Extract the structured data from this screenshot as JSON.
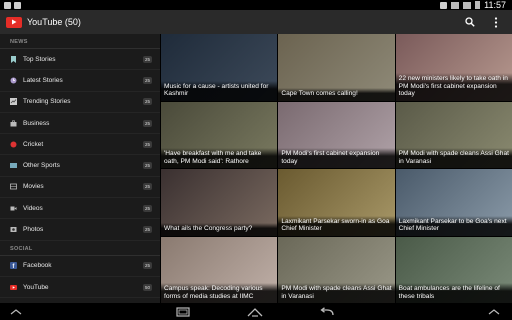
{
  "app": {
    "title": "YouTube (50)",
    "accent": "#e52d27"
  },
  "status": {
    "clock": "11:57"
  },
  "sidebar": {
    "sections": [
      {
        "header": "NEWS",
        "items": [
          {
            "label": "Top Stories",
            "count": "25",
            "icon": "bookmark-icon"
          },
          {
            "label": "Latest Stories",
            "count": "25",
            "icon": "clock-icon"
          },
          {
            "label": "Trending Stories",
            "count": "25",
            "icon": "trending-icon"
          },
          {
            "label": "Business",
            "count": "25",
            "icon": "briefcase-icon"
          },
          {
            "label": "Cricket",
            "count": "25",
            "icon": "cricket-icon"
          },
          {
            "label": "Other Sports",
            "count": "25",
            "icon": "sports-icon"
          },
          {
            "label": "Movies",
            "count": "25",
            "icon": "film-icon"
          },
          {
            "label": "Videos",
            "count": "25",
            "icon": "video-icon"
          },
          {
            "label": "Photos",
            "count": "25",
            "icon": "photo-icon"
          }
        ]
      },
      {
        "header": "SOCIAL",
        "items": [
          {
            "label": "Facebook",
            "count": "25",
            "icon": "facebook-icon"
          },
          {
            "label": "YouTube",
            "count": "50",
            "icon": "youtube-icon"
          }
        ]
      }
    ]
  },
  "tiles": [
    {
      "caption": "Music for a cause - artists united for Kashmir",
      "colors": [
        "#1f2b3a",
        "#3d4a5a"
      ]
    },
    {
      "caption": "Cape Town comes calling!",
      "colors": [
        "#6b6350",
        "#8f8a78"
      ]
    },
    {
      "caption": "22 new ministers likely to take oath in PM Modi's first cabinet expansion today",
      "colors": [
        "#7a5a5a",
        "#b89a90"
      ]
    },
    {
      "caption": "'Have breakfast with me and take oath, PM Modi said': Rathore",
      "colors": [
        "#4a4a3a",
        "#7a7a60"
      ]
    },
    {
      "caption": "PM Modi's first cabinet expansion today",
      "colors": [
        "#7a6a70",
        "#b0a2a8"
      ]
    },
    {
      "caption": "PM Modi with spade cleans Assi Ghat in Varanasi",
      "colors": [
        "#5a5a48",
        "#8a8a70"
      ]
    },
    {
      "caption": "What ails the Congress party?",
      "colors": [
        "#3a3030",
        "#7a6a60"
      ]
    },
    {
      "caption": "Laxmikant Parsekar sworn-in as Goa Chief Minister",
      "colors": [
        "#6a5a30",
        "#a89868"
      ]
    },
    {
      "caption": "Laxmikant Parsekar to be Goa's next Chief Minister",
      "colors": [
        "#4a5a6a",
        "#8a9aa8"
      ]
    },
    {
      "caption": "Campus speak: Decoding various forms of media studies at IIMC",
      "colors": [
        "#8a7a70",
        "#c0b0a8"
      ]
    },
    {
      "caption": "PM Modi with spade cleans Assi Ghat in Varanasi",
      "colors": [
        "#6a6858",
        "#9a9888"
      ]
    },
    {
      "caption": "Boat ambulances are the lifeline of these tribals",
      "colors": [
        "#4a5a48",
        "#7a8a78"
      ]
    }
  ]
}
